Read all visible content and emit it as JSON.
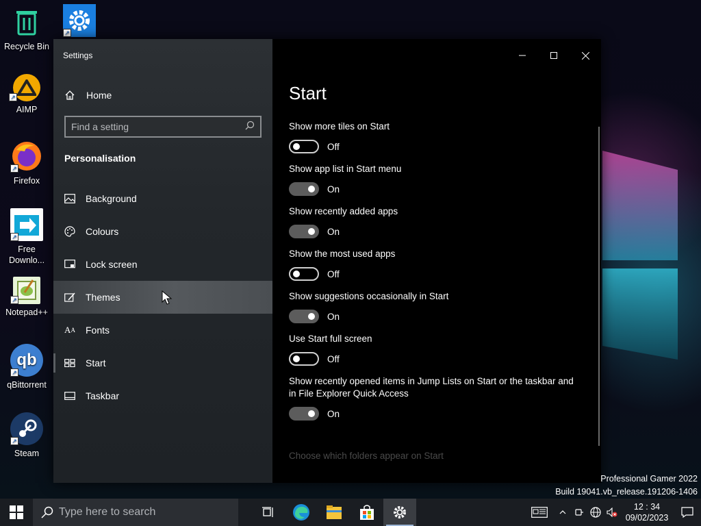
{
  "desktop": {
    "icons": [
      {
        "label": "Recycle Bin"
      },
      {
        "label": ""
      },
      {
        "label": "AIMP"
      },
      {
        "label": "Firefox"
      },
      {
        "label": "Free Downlo..."
      },
      {
        "label": "Notepad++"
      },
      {
        "label": "qBittorrent"
      },
      {
        "label": "Steam"
      }
    ],
    "watermark_line1": "Professional Gamer 2022",
    "watermark_line2": "Build 19041.vb_release.191206-1406"
  },
  "settings": {
    "window_title": "Settings",
    "home_label": "Home",
    "search_placeholder": "Find a setting",
    "section_heading": "Personalisation",
    "nav_items": [
      {
        "label": "Background",
        "icon": "image-icon"
      },
      {
        "label": "Colours",
        "icon": "palette-icon"
      },
      {
        "label": "Lock screen",
        "icon": "lock-screen-icon"
      },
      {
        "label": "Themes",
        "icon": "themes-icon",
        "active": true
      },
      {
        "label": "Fonts",
        "icon": "fonts-icon"
      },
      {
        "label": "Start",
        "icon": "start-icon"
      },
      {
        "label": "Taskbar",
        "icon": "taskbar-icon"
      }
    ],
    "page_title": "Start",
    "options": [
      {
        "label": "Show more tiles on Start",
        "state": "Off"
      },
      {
        "label": "Show app list in Start menu",
        "state": "On"
      },
      {
        "label": "Show recently added apps",
        "state": "On"
      },
      {
        "label": "Show the most used apps",
        "state": "Off"
      },
      {
        "label": "Show suggestions occasionally in Start",
        "state": "On"
      },
      {
        "label": "Use Start full screen",
        "state": "Off"
      },
      {
        "label": "Show recently opened items in Jump Lists on Start or the taskbar and in File Explorer Quick Access",
        "state": "On"
      }
    ],
    "folders_link": "Choose which folders appear on Start"
  },
  "taskbar": {
    "search_placeholder": "Type here to search",
    "apps": [
      "task-view-icon",
      "edge-icon",
      "file-explorer-icon",
      "store-icon",
      "settings-icon"
    ],
    "clock_time": "12 : 34",
    "clock_date": "09/02/2023"
  },
  "colors": {
    "accent": "#9fb8d8",
    "toggle_on": "#5c5c5c",
    "sidebar_bg": "#2c3034"
  }
}
